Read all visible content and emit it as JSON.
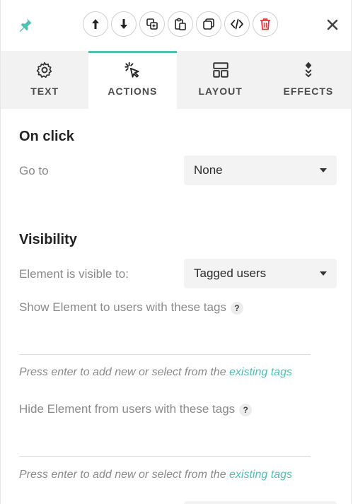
{
  "toolbar": {
    "buttons": [
      "move-up",
      "move-down",
      "duplicate",
      "paste",
      "copy",
      "code",
      "delete"
    ]
  },
  "tabs": [
    {
      "label": "TEXT",
      "icon": "gear-icon"
    },
    {
      "label": "ACTIONS",
      "icon": "cursor-click-icon",
      "active": true
    },
    {
      "label": "LAYOUT",
      "icon": "layout-icon"
    },
    {
      "label": "EFFECTS",
      "icon": "effects-icon"
    }
  ],
  "on_click": {
    "title": "On click",
    "goto_label": "Go to",
    "goto_value": "None"
  },
  "visibility": {
    "title": "Visibility",
    "visible_to_label": "Element is visible to:",
    "visible_to_value": "Tagged users",
    "show_label": "Show Element to users with these tags",
    "hide_label": "Hide Element from users with these tags",
    "help_glyph": "?",
    "hint_prefix": "Press enter to add new or select from the ",
    "hint_link": "existing tags"
  },
  "colors": {
    "accent": "#4fc2b4",
    "delete": "#e0363b"
  }
}
